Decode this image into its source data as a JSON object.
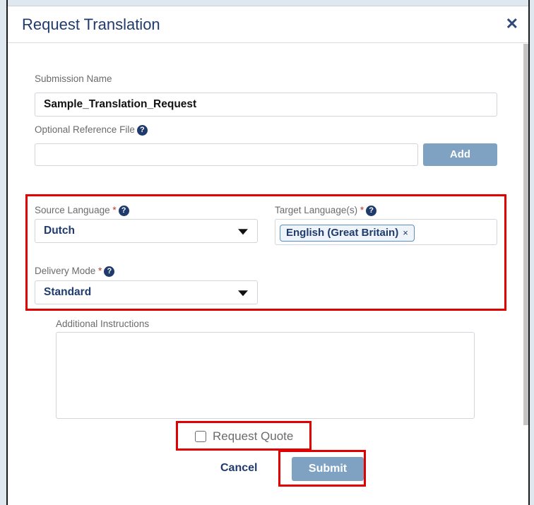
{
  "dialog": {
    "title": "Request Translation",
    "close_icon": "close-icon"
  },
  "form": {
    "submission_name": {
      "label": "Submission Name",
      "value": "Sample_Translation_Request"
    },
    "reference_file": {
      "label": "Optional Reference File",
      "value": "",
      "add_label": "Add"
    },
    "source_language": {
      "label": "Source Language",
      "required_mark": "*",
      "value": "Dutch"
    },
    "target_languages": {
      "label": "Target Language(s)",
      "required_mark": "*",
      "tags": [
        "English (Great Britain)"
      ],
      "remove_glyph": "×"
    },
    "delivery_mode": {
      "label": "Delivery Mode",
      "required_mark": "*",
      "value": "Standard"
    },
    "additional_instructions": {
      "label": "Additional Instructions",
      "value": ""
    },
    "request_quote": {
      "label": "Request Quote",
      "checked": false
    },
    "help_glyph": "?"
  },
  "actions": {
    "cancel_label": "Cancel",
    "submit_label": "Submit"
  },
  "colors": {
    "accent": "#1f3b6d",
    "button": "#7fa2c3",
    "highlight": "#e00000"
  }
}
